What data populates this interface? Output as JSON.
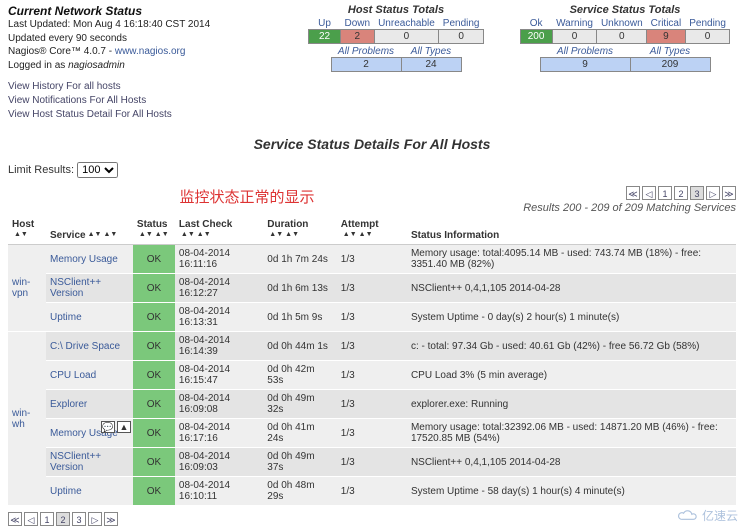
{
  "header": {
    "title": "Current Network Status",
    "last_updated": "Last Updated: Mon Aug 4 16:18:40 CST 2014",
    "update_every": "Updated every 90 seconds",
    "product_prefix": "Nagios® Core™ 4.0.7 - ",
    "product_link": "www.nagios.org",
    "logged_in_prefix": "Logged in as ",
    "logged_in_user": "nagiosadmin"
  },
  "links": {
    "history": "View History For all hosts",
    "notifications": "View Notifications For All Hosts",
    "hoststatus": "View Host Status Detail For All Hosts"
  },
  "host_totals": {
    "title": "Host Status Totals",
    "cols": [
      "Up",
      "Down",
      "Unreachable",
      "Pending"
    ],
    "vals": [
      "22",
      "2",
      "0",
      "0"
    ],
    "all_problems_lbl": "All Problems",
    "all_types_lbl": "All Types",
    "all_problems": "2",
    "all_types": "24"
  },
  "svc_totals": {
    "title": "Service Status Totals",
    "cols": [
      "Ok",
      "Warning",
      "Unknown",
      "Critical",
      "Pending"
    ],
    "vals": [
      "200",
      "0",
      "0",
      "9",
      "0"
    ],
    "all_problems_lbl": "All Problems",
    "all_types_lbl": "All Types",
    "all_problems": "9",
    "all_types": "209"
  },
  "section_title": "Service Status Details For All Hosts",
  "limit_label": "Limit Results:",
  "limit_value": "100",
  "annotation": "监控状态正常的显示",
  "results_summary": "Results 200 - 209 of 209 Matching Services",
  "pages": [
    "1",
    "2",
    "3"
  ],
  "page_sel_top": "3",
  "page_sel_bot": "2",
  "th": {
    "host": "Host",
    "svc": "Service",
    "status": "Status",
    "last": "Last Check",
    "dur": "Duration",
    "att": "Attempt",
    "info": "Status Information"
  },
  "rows": [
    {
      "host": "win-vpn",
      "svc": "Memory Usage",
      "status": "OK",
      "last": "08-04-2014 16:11:16",
      "dur": "0d 1h 7m 24s",
      "att": "1/3",
      "info": "Memory usage: total:4095.14 MB - used: 743.74 MB (18%) - free: 3351.40 MB (82%)",
      "span": 3
    },
    {
      "svc": "NSClient++ Version",
      "status": "OK",
      "last": "08-04-2014 16:12:27",
      "dur": "0d 1h 6m 13s",
      "att": "1/3",
      "info": "NSClient++ 0,4,1,105 2014-04-28"
    },
    {
      "svc": "Uptime",
      "status": "OK",
      "last": "08-04-2014 16:13:31",
      "dur": "0d 1h 5m 9s",
      "att": "1/3",
      "info": "System Uptime - 0 day(s) 2 hour(s) 1 minute(s)"
    },
    {
      "host": "win-wh",
      "svc": "C:\\ Drive Space",
      "status": "OK",
      "last": "08-04-2014 16:14:39",
      "dur": "0d 0h 44m 1s",
      "att": "1/3",
      "info": "c: - total: 97.34 Gb - used: 40.61 Gb (42%) - free 56.72 Gb (58%)",
      "span": 6
    },
    {
      "svc": "CPU Load",
      "status": "OK",
      "last": "08-04-2014 16:15:47",
      "dur": "0d 0h 42m 53s",
      "att": "1/3",
      "info": "CPU Load 3% (5 min average)"
    },
    {
      "svc": "Explorer",
      "status": "OK",
      "last": "08-04-2014 16:09:08",
      "dur": "0d 0h 49m 32s",
      "att": "1/3",
      "info": "explorer.exe: Running"
    },
    {
      "svc": "Memory Usage",
      "status": "OK",
      "last": "08-04-2014 16:17:16",
      "dur": "0d 0h 41m 24s",
      "att": "1/3",
      "info": "Memory usage: total:32392.06 MB - used: 14871.20 MB (46%) - free: 17520.85 MB (54%)",
      "btns": true
    },
    {
      "svc": "NSClient++ Version",
      "status": "OK",
      "last": "08-04-2014 16:09:03",
      "dur": "0d 0h 49m 37s",
      "att": "1/3",
      "info": "NSClient++ 0,4,1,105 2014-04-28"
    },
    {
      "svc": "Uptime",
      "status": "OK",
      "last": "08-04-2014 16:10:11",
      "dur": "0d 0h 48m 29s",
      "att": "1/3",
      "info": "System Uptime - 58 day(s) 1 hour(s) 4 minute(s)"
    }
  ],
  "watermark": "亿速云"
}
